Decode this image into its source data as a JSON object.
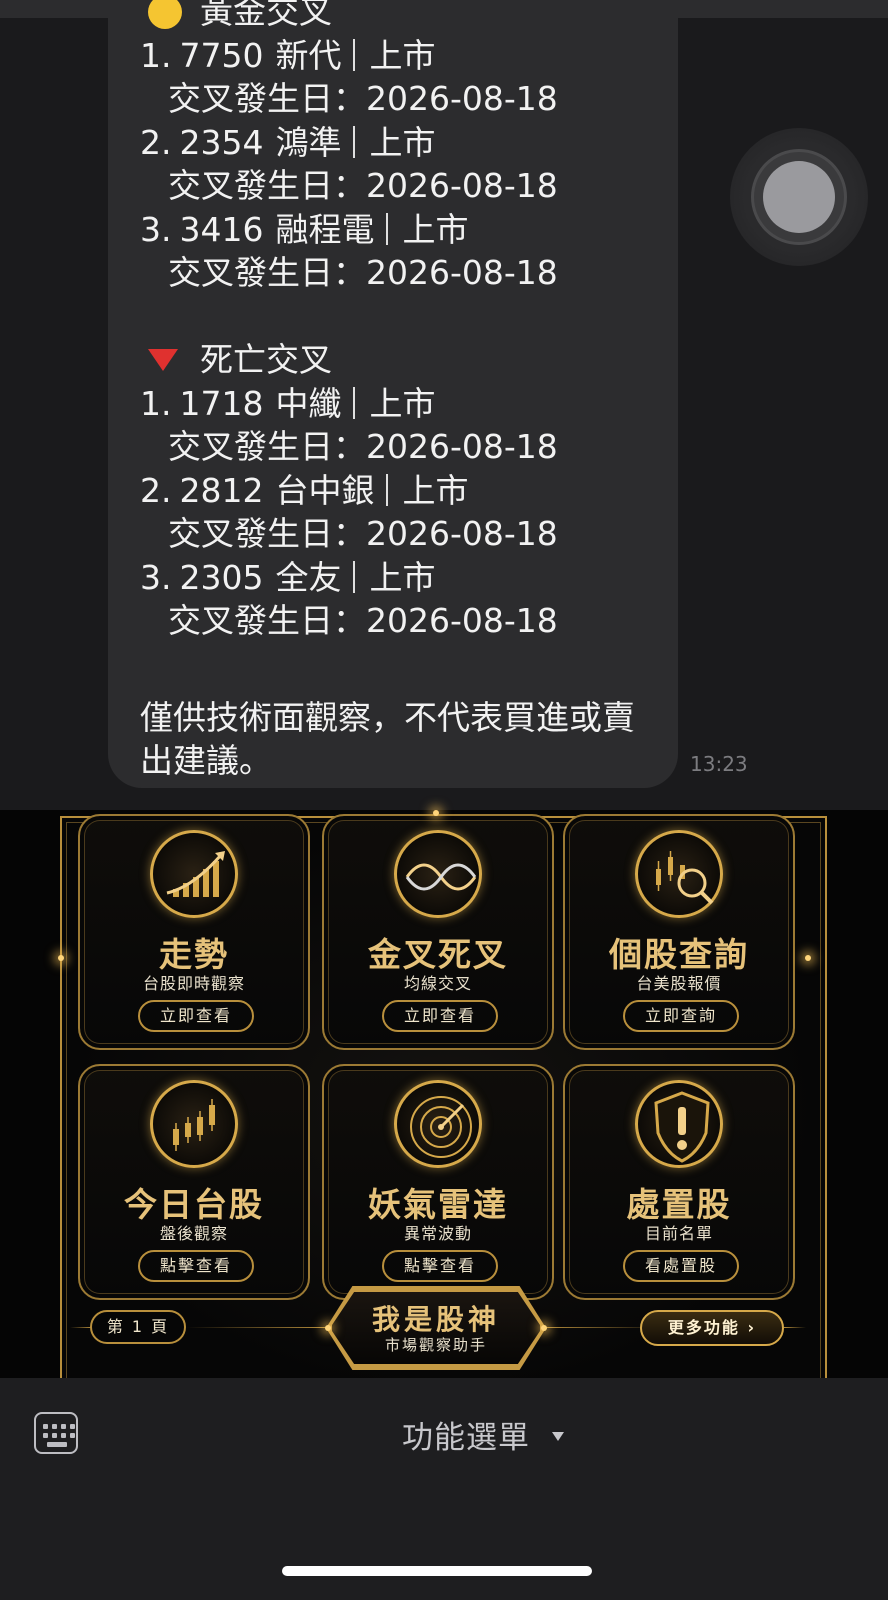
{
  "chat": {
    "golden_cross_heading": "黃金交叉",
    "golden_cross": [
      {
        "rank": "1.",
        "code": "7750",
        "name": "新代",
        "market": "上市",
        "date_label": "交叉發生日：",
        "date": "2026-08-18"
      },
      {
        "rank": "2.",
        "code": "2354",
        "name": "鴻準",
        "market": "上市",
        "date_label": "交叉發生日：",
        "date": "2026-08-18"
      },
      {
        "rank": "3.",
        "code": "3416",
        "name": "融程電",
        "market": "上市",
        "date_label": "交叉發生日：",
        "date": "2026-08-18"
      }
    ],
    "death_cross_heading": "死亡交叉",
    "death_cross": [
      {
        "rank": "1.",
        "code": "1718",
        "name": "中纖",
        "market": "上市",
        "date_label": "交叉發生日：",
        "date": "2026-08-18"
      },
      {
        "rank": "2.",
        "code": "2812",
        "name": "台中銀",
        "market": "上市",
        "date_label": "交叉發生日：",
        "date": "2026-08-18"
      },
      {
        "rank": "3.",
        "code": "2305",
        "name": "全友",
        "market": "上市",
        "date_label": "交叉發生日：",
        "date": "2026-08-18"
      }
    ],
    "disclaimer": "僅供技術面觀察，不代表買進或賣出建議。",
    "timestamp": "13:23"
  },
  "rich_menu": {
    "cards": [
      {
        "title": "走勢",
        "subtitle": "台股即時觀察",
        "button": "立即查看",
        "icon": "trend-chart-icon"
      },
      {
        "title": "金叉死叉",
        "subtitle": "均線交叉",
        "button": "立即查看",
        "icon": "wave-cross-icon"
      },
      {
        "title": "個股查詢",
        "subtitle": "台美股報價",
        "button": "立即查詢",
        "icon": "candlestick-search-icon"
      },
      {
        "title": "今日台股",
        "subtitle": "盤後觀察",
        "button": "點擊查看",
        "icon": "candlestick-icon"
      },
      {
        "title": "妖氣雷達",
        "subtitle": "異常波動",
        "button": "點擊查看",
        "icon": "radar-icon"
      },
      {
        "title": "處置股",
        "subtitle": "目前名單",
        "button": "看處置股",
        "icon": "shield-alert-icon"
      }
    ],
    "page_label": "第 1 頁",
    "brand_title": "我是股神",
    "brand_subtitle": "市場觀察助手",
    "more_label": "更多功能 ›"
  },
  "bottom_bar": {
    "menu_label": "功能選單",
    "keyboard_icon": "keyboard-icon"
  },
  "colors": {
    "gold": "#d6a94a",
    "bubble": "#2c2c2e",
    "down_red": "#e0312f"
  }
}
